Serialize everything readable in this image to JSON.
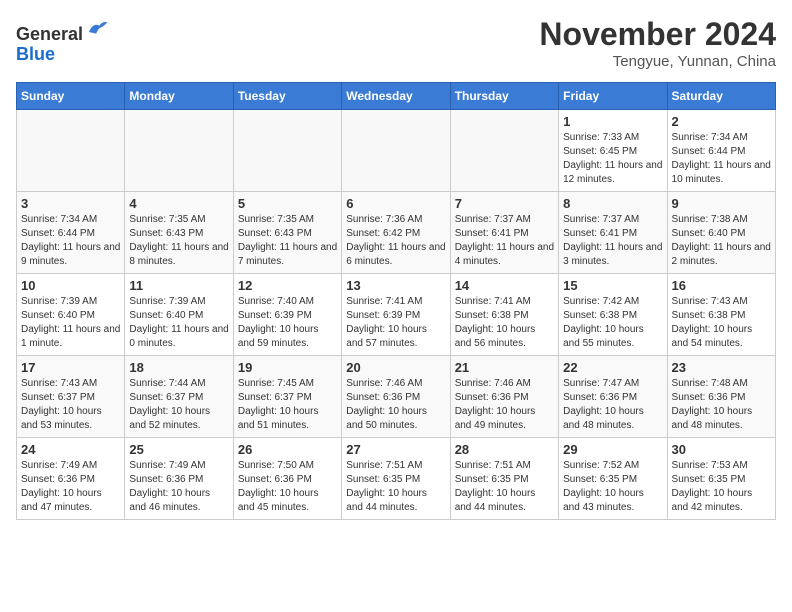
{
  "header": {
    "logo_line1": "General",
    "logo_line2": "Blue",
    "month_title": "November 2024",
    "location": "Tengyue, Yunnan, China"
  },
  "weekdays": [
    "Sunday",
    "Monday",
    "Tuesday",
    "Wednesday",
    "Thursday",
    "Friday",
    "Saturday"
  ],
  "weeks": [
    [
      {
        "day": "",
        "info": ""
      },
      {
        "day": "",
        "info": ""
      },
      {
        "day": "",
        "info": ""
      },
      {
        "day": "",
        "info": ""
      },
      {
        "day": "",
        "info": ""
      },
      {
        "day": "1",
        "info": "Sunrise: 7:33 AM\nSunset: 6:45 PM\nDaylight: 11 hours and 12 minutes."
      },
      {
        "day": "2",
        "info": "Sunrise: 7:34 AM\nSunset: 6:44 PM\nDaylight: 11 hours and 10 minutes."
      }
    ],
    [
      {
        "day": "3",
        "info": "Sunrise: 7:34 AM\nSunset: 6:44 PM\nDaylight: 11 hours and 9 minutes."
      },
      {
        "day": "4",
        "info": "Sunrise: 7:35 AM\nSunset: 6:43 PM\nDaylight: 11 hours and 8 minutes."
      },
      {
        "day": "5",
        "info": "Sunrise: 7:35 AM\nSunset: 6:43 PM\nDaylight: 11 hours and 7 minutes."
      },
      {
        "day": "6",
        "info": "Sunrise: 7:36 AM\nSunset: 6:42 PM\nDaylight: 11 hours and 6 minutes."
      },
      {
        "day": "7",
        "info": "Sunrise: 7:37 AM\nSunset: 6:41 PM\nDaylight: 11 hours and 4 minutes."
      },
      {
        "day": "8",
        "info": "Sunrise: 7:37 AM\nSunset: 6:41 PM\nDaylight: 11 hours and 3 minutes."
      },
      {
        "day": "9",
        "info": "Sunrise: 7:38 AM\nSunset: 6:40 PM\nDaylight: 11 hours and 2 minutes."
      }
    ],
    [
      {
        "day": "10",
        "info": "Sunrise: 7:39 AM\nSunset: 6:40 PM\nDaylight: 11 hours and 1 minute."
      },
      {
        "day": "11",
        "info": "Sunrise: 7:39 AM\nSunset: 6:40 PM\nDaylight: 11 hours and 0 minutes."
      },
      {
        "day": "12",
        "info": "Sunrise: 7:40 AM\nSunset: 6:39 PM\nDaylight: 10 hours and 59 minutes."
      },
      {
        "day": "13",
        "info": "Sunrise: 7:41 AM\nSunset: 6:39 PM\nDaylight: 10 hours and 57 minutes."
      },
      {
        "day": "14",
        "info": "Sunrise: 7:41 AM\nSunset: 6:38 PM\nDaylight: 10 hours and 56 minutes."
      },
      {
        "day": "15",
        "info": "Sunrise: 7:42 AM\nSunset: 6:38 PM\nDaylight: 10 hours and 55 minutes."
      },
      {
        "day": "16",
        "info": "Sunrise: 7:43 AM\nSunset: 6:38 PM\nDaylight: 10 hours and 54 minutes."
      }
    ],
    [
      {
        "day": "17",
        "info": "Sunrise: 7:43 AM\nSunset: 6:37 PM\nDaylight: 10 hours and 53 minutes."
      },
      {
        "day": "18",
        "info": "Sunrise: 7:44 AM\nSunset: 6:37 PM\nDaylight: 10 hours and 52 minutes."
      },
      {
        "day": "19",
        "info": "Sunrise: 7:45 AM\nSunset: 6:37 PM\nDaylight: 10 hours and 51 minutes."
      },
      {
        "day": "20",
        "info": "Sunrise: 7:46 AM\nSunset: 6:36 PM\nDaylight: 10 hours and 50 minutes."
      },
      {
        "day": "21",
        "info": "Sunrise: 7:46 AM\nSunset: 6:36 PM\nDaylight: 10 hours and 49 minutes."
      },
      {
        "day": "22",
        "info": "Sunrise: 7:47 AM\nSunset: 6:36 PM\nDaylight: 10 hours and 48 minutes."
      },
      {
        "day": "23",
        "info": "Sunrise: 7:48 AM\nSunset: 6:36 PM\nDaylight: 10 hours and 48 minutes."
      }
    ],
    [
      {
        "day": "24",
        "info": "Sunrise: 7:49 AM\nSunset: 6:36 PM\nDaylight: 10 hours and 47 minutes."
      },
      {
        "day": "25",
        "info": "Sunrise: 7:49 AM\nSunset: 6:36 PM\nDaylight: 10 hours and 46 minutes."
      },
      {
        "day": "26",
        "info": "Sunrise: 7:50 AM\nSunset: 6:36 PM\nDaylight: 10 hours and 45 minutes."
      },
      {
        "day": "27",
        "info": "Sunrise: 7:51 AM\nSunset: 6:35 PM\nDaylight: 10 hours and 44 minutes."
      },
      {
        "day": "28",
        "info": "Sunrise: 7:51 AM\nSunset: 6:35 PM\nDaylight: 10 hours and 44 minutes."
      },
      {
        "day": "29",
        "info": "Sunrise: 7:52 AM\nSunset: 6:35 PM\nDaylight: 10 hours and 43 minutes."
      },
      {
        "day": "30",
        "info": "Sunrise: 7:53 AM\nSunset: 6:35 PM\nDaylight: 10 hours and 42 minutes."
      }
    ]
  ]
}
